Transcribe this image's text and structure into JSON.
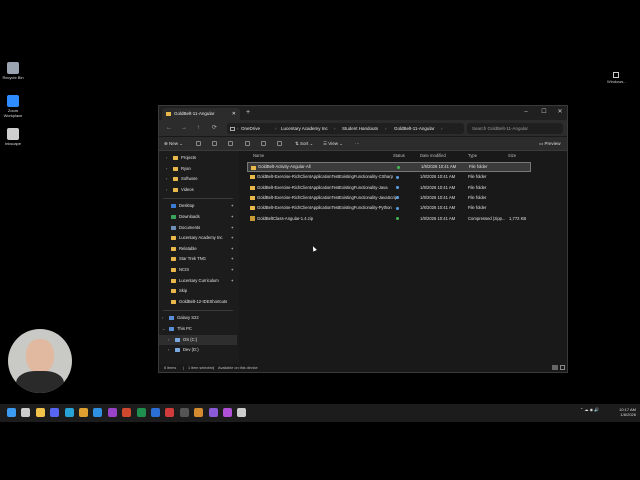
{
  "desktop": {
    "icons": [
      {
        "label": "Recycle Bin",
        "icon": "recycle-bin-icon",
        "color": "#9aa5b1"
      },
      {
        "label": "Zoom Workplace",
        "icon": "zoom-icon",
        "color": "#2d8cff"
      },
      {
        "label": "Inkscape",
        "icon": "inkscape-icon",
        "color": "#cfcfcf"
      }
    ],
    "top_right_label": "Windows..."
  },
  "window": {
    "tab_title": "GoldBelt-11-Angular",
    "new_tab_symbol": "+",
    "controls": {
      "minimize": "–",
      "maximize": "☐",
      "close": "✕"
    },
    "breadcrumb": [
      "OneDrive",
      "Lucentary Academy Inc",
      "Student Handouts",
      "GoldBelt-11-Angular"
    ],
    "search_placeholder": "Search GoldBelt-11-Angular",
    "toolbar": {
      "new": "New",
      "sort": "Sort",
      "view": "View",
      "more": "···",
      "preview": "Preview"
    },
    "sidebar": {
      "groups_top": [
        {
          "label": "Projects",
          "chev": "›"
        },
        {
          "label": "Ryan",
          "chev": "›"
        },
        {
          "label": "Software",
          "chev": "›"
        },
        {
          "label": "Videos",
          "chev": "›"
        }
      ],
      "quick_access": [
        {
          "label": "Desktop",
          "icon": "desktop-icon",
          "color": "#3a7bd5",
          "pin": "✦"
        },
        {
          "label": "Downloads",
          "icon": "download-icon",
          "color": "#3aa35b",
          "pin": "✦"
        },
        {
          "label": "Documents",
          "icon": "document-icon",
          "color": "#6e8fb5",
          "pin": "✦"
        },
        {
          "label": "Lucentary Academy Inc",
          "icon": "folder-icon",
          "color": "#e8b84a",
          "pin": "✦"
        },
        {
          "label": "Relatable",
          "icon": "folder-icon",
          "color": "#e8b84a",
          "pin": "✦"
        },
        {
          "label": "Star Trek TNG",
          "icon": "folder-icon",
          "color": "#e8b84a",
          "pin": "✦"
        },
        {
          "label": "NCIS",
          "icon": "folder-icon",
          "color": "#e8b84a",
          "pin": "✦"
        },
        {
          "label": "Lucentary Curriculum",
          "icon": "folder-icon",
          "color": "#e8b84a",
          "pin": "✦"
        },
        {
          "label": "Skip",
          "icon": "folder-icon",
          "color": "#e8b84a",
          "pin": ""
        },
        {
          "label": "GoldBelt-12-IDEShortcuts",
          "icon": "folder-icon",
          "color": "#e8b84a",
          "pin": ""
        }
      ],
      "devices": [
        {
          "label": "Galaxy S22",
          "icon": "phone-icon",
          "color": "#5a8fd8",
          "chev": "›"
        },
        {
          "label": "This PC",
          "icon": "pc-icon",
          "color": "#5a8fd8",
          "chev": "⌄"
        },
        {
          "label": "OS (C:)",
          "icon": "drive-icon",
          "color": "#7aa7e0",
          "chev": "›"
        },
        {
          "label": "Dev (D:)",
          "icon": "drive-icon",
          "color": "#7aa7e0",
          "chev": "›"
        }
      ]
    },
    "columns": {
      "name": "Name",
      "status": "Status",
      "date": "Date modified",
      "type": "Type",
      "size": "Size"
    },
    "files": [
      {
        "name": "GoldBelt-Activity-Angular-All",
        "kind": "folder",
        "status_color": "#3fb950",
        "date": "1/8/2026 10:41 AM",
        "type": "File folder",
        "size": "",
        "selected": true
      },
      {
        "name": "GoldBelt-Exercise-RichClientApplicationTestExistingFunctionality-CSharp",
        "kind": "folder",
        "status_color": "#5aa0e6",
        "date": "1/8/2026 10:41 AM",
        "type": "File folder",
        "size": "",
        "selected": false
      },
      {
        "name": "GoldBelt-Exercise-RichClientApplicationTestExistingFunctionality-Java",
        "kind": "folder",
        "status_color": "#5aa0e6",
        "date": "1/8/2026 10:41 AM",
        "type": "File folder",
        "size": "",
        "selected": false
      },
      {
        "name": "GoldBelt-Exercise-RichClientApplicationTestExistingFunctionality-JavaScript",
        "kind": "folder",
        "status_color": "#5aa0e6",
        "date": "1/8/2026 10:41 AM",
        "type": "File folder",
        "size": "",
        "selected": false
      },
      {
        "name": "GoldBelt-Exercise-RichClientApplicationTestExistingFunctionality-Python",
        "kind": "folder",
        "status_color": "#5aa0e6",
        "date": "1/8/2026 10:41 AM",
        "type": "File folder",
        "size": "",
        "selected": false
      },
      {
        "name": "GoldBeltClass-Angular-1.4.zip",
        "kind": "zip",
        "status_color": "#3fb950",
        "date": "1/8/2026 10:41 AM",
        "type": "Compressed (zipp...",
        "size": "1,772 KB",
        "selected": false
      }
    ],
    "status_bar": {
      "count": "6 items",
      "selected": "1 item selected",
      "availability": "Available on this device"
    }
  },
  "taskbar": {
    "apps": [
      {
        "icon": "windows-start-icon",
        "color": "#3a9bf0"
      },
      {
        "icon": "search-icon",
        "color": "#cccccc"
      },
      {
        "icon": "file-explorer-icon",
        "color": "#f1c34a"
      },
      {
        "icon": "chat-icon",
        "color": "#5865f2"
      },
      {
        "icon": "edge-icon",
        "color": "#27a3d8"
      },
      {
        "icon": "chrome-icon",
        "color": "#e0a030"
      },
      {
        "icon": "vscode-icon",
        "color": "#2f8fe0"
      },
      {
        "icon": "onenote-icon",
        "color": "#9a42c8"
      },
      {
        "icon": "powerpoint-icon",
        "color": "#d0482e"
      },
      {
        "icon": "excel-icon",
        "color": "#1f8f4e"
      },
      {
        "icon": "word-icon",
        "color": "#2b6fd6"
      },
      {
        "icon": "record-icon",
        "color": "#d23b3b"
      },
      {
        "icon": "terminal-icon",
        "color": "#555555"
      },
      {
        "icon": "tools-icon",
        "color": "#d48a2e"
      },
      {
        "icon": "visual-studio-icon",
        "color": "#8a5ad8"
      },
      {
        "icon": "rider-icon",
        "color": "#b04fd8"
      },
      {
        "icon": "unity-icon",
        "color": "#cccccc"
      }
    ],
    "time": "10:17 AM",
    "date": "1/8/2026"
  }
}
